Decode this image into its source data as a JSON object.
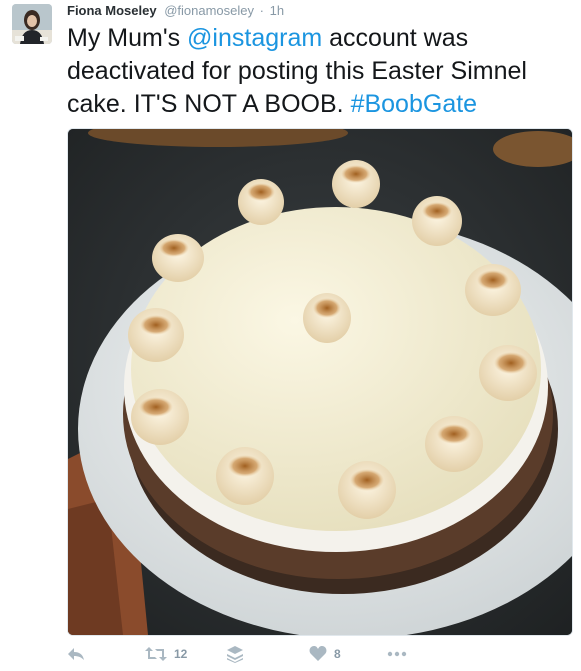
{
  "tweet": {
    "author_name": "Fiona Moseley",
    "author_handle": "@fionamoseley",
    "separator": "·",
    "time": "1h",
    "text_1": "My Mum's ",
    "mention": "@instagram",
    "text_2": " account was deactivated for posting this Easter Simnel cake. IT'S NOT A BOOB. ",
    "hashtag": "#BoobGate",
    "link_color": "#1b95e0"
  },
  "actions": {
    "retweet_count": "12",
    "like_count": "8",
    "icons": [
      "reply-icon",
      "retweet-icon",
      "stack-icon",
      "heart-icon",
      "more-icon"
    ]
  },
  "media": {
    "description_icon": "photo-of-simnel-cake"
  }
}
